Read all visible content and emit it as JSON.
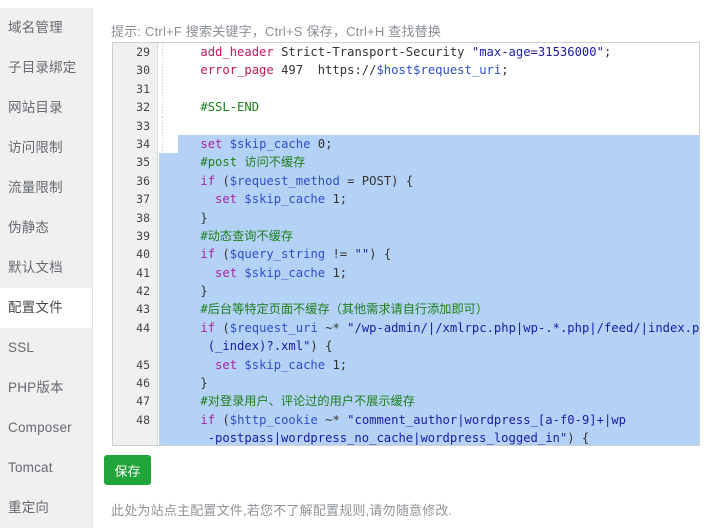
{
  "sidebar": {
    "items": [
      {
        "label": "域名管理",
        "active": false
      },
      {
        "label": "子目录绑定",
        "active": false
      },
      {
        "label": "网站目录",
        "active": false
      },
      {
        "label": "访问限制",
        "active": false
      },
      {
        "label": "流量限制",
        "active": false
      },
      {
        "label": "伪静态",
        "active": false
      },
      {
        "label": "默认文档",
        "active": false
      },
      {
        "label": "配置文件",
        "active": true
      },
      {
        "label": "SSL",
        "active": false
      },
      {
        "label": "PHP版本",
        "active": false
      },
      {
        "label": "Composer",
        "active": false
      },
      {
        "label": "Tomcat",
        "active": false
      },
      {
        "label": "重定向",
        "active": false
      }
    ]
  },
  "main": {
    "hint": "提示: Ctrl+F 搜索关键字，Ctrl+S 保存，Ctrl+H 查找替换",
    "save_label": "保存",
    "footer_note": "此处为站点主配置文件,若您不了解配置规则,请勿随意修改."
  },
  "editor": {
    "colors": {
      "selection": "#b4d2f5",
      "gutter_bg": "#f0f0f0",
      "comment": "#1d7f1d",
      "string": "#1a1aa6",
      "keyword": "#a626a4",
      "function": "#c2185b",
      "variable": "#2f4fc7",
      "accent_green": "#20a53a"
    },
    "gutter_numbers": [
      "29",
      "30",
      "31",
      "32",
      "33",
      "34",
      "35",
      "36",
      "37",
      "38",
      "39",
      "40",
      "41",
      "42",
      "43",
      "44",
      "",
      "45",
      "46",
      "47",
      "48",
      ""
    ],
    "lines": [
      {
        "n": "29",
        "selected": false,
        "partial": false,
        "tokens": [
          {
            "t": "    ",
            "c": "pl"
          },
          {
            "t": "add_header",
            "c": "fn"
          },
          {
            "t": " Strict-Transport-Security ",
            "c": "pl"
          },
          {
            "t": "\"max-age=31536000\"",
            "c": "str"
          },
          {
            "t": ";",
            "c": "pl"
          }
        ]
      },
      {
        "n": "30",
        "selected": false,
        "partial": false,
        "tokens": [
          {
            "t": "    ",
            "c": "pl"
          },
          {
            "t": "error_page",
            "c": "fn"
          },
          {
            "t": " 497  https://",
            "c": "pl"
          },
          {
            "t": "$host$request_uri",
            "c": "var"
          },
          {
            "t": ";",
            "c": "pl"
          }
        ]
      },
      {
        "n": "31",
        "selected": false,
        "partial": false,
        "tokens": []
      },
      {
        "n": "32",
        "selected": false,
        "partial": false,
        "tokens": [
          {
            "t": "    ",
            "c": "pl"
          },
          {
            "t": "#SSL-END",
            "c": "cmt"
          }
        ]
      },
      {
        "n": "33",
        "selected": false,
        "partial": false,
        "tokens": []
      },
      {
        "n": "34",
        "selected": true,
        "partial": true,
        "tokens": [
          {
            "t": "    ",
            "c": "pl"
          },
          {
            "t": "set",
            "c": "kw"
          },
          {
            "t": " ",
            "c": "pl"
          },
          {
            "t": "$skip_cache",
            "c": "var"
          },
          {
            "t": " 0;",
            "c": "pl"
          }
        ]
      },
      {
        "n": "35",
        "selected": true,
        "partial": false,
        "tokens": [
          {
            "t": "    ",
            "c": "pl"
          },
          {
            "t": "#post 访问不缓存",
            "c": "cmt"
          }
        ]
      },
      {
        "n": "36",
        "selected": true,
        "partial": false,
        "tokens": [
          {
            "t": "    ",
            "c": "pl"
          },
          {
            "t": "if",
            "c": "kw"
          },
          {
            "t": " (",
            "c": "pl"
          },
          {
            "t": "$request_method",
            "c": "var"
          },
          {
            "t": " = POST) {",
            "c": "pl"
          }
        ]
      },
      {
        "n": "37",
        "selected": true,
        "partial": false,
        "tokens": [
          {
            "t": "      ",
            "c": "pl"
          },
          {
            "t": "set",
            "c": "kw"
          },
          {
            "t": " ",
            "c": "pl"
          },
          {
            "t": "$skip_cache",
            "c": "var"
          },
          {
            "t": " 1;",
            "c": "pl"
          }
        ]
      },
      {
        "n": "38",
        "selected": true,
        "partial": false,
        "tokens": [
          {
            "t": "    }",
            "c": "pl"
          }
        ]
      },
      {
        "n": "39",
        "selected": true,
        "partial": false,
        "tokens": [
          {
            "t": "    ",
            "c": "pl"
          },
          {
            "t": "#动态查询不缓存",
            "c": "cmt"
          }
        ]
      },
      {
        "n": "40",
        "selected": true,
        "partial": false,
        "tokens": [
          {
            "t": "    ",
            "c": "pl"
          },
          {
            "t": "if",
            "c": "kw"
          },
          {
            "t": " (",
            "c": "pl"
          },
          {
            "t": "$query_string",
            "c": "var"
          },
          {
            "t": " != ",
            "c": "pl"
          },
          {
            "t": "\"\"",
            "c": "str"
          },
          {
            "t": ") {",
            "c": "pl"
          }
        ]
      },
      {
        "n": "41",
        "selected": true,
        "partial": false,
        "tokens": [
          {
            "t": "      ",
            "c": "pl"
          },
          {
            "t": "set",
            "c": "kw"
          },
          {
            "t": " ",
            "c": "pl"
          },
          {
            "t": "$skip_cache",
            "c": "var"
          },
          {
            "t": " 1;",
            "c": "pl"
          }
        ]
      },
      {
        "n": "42",
        "selected": true,
        "partial": false,
        "tokens": [
          {
            "t": "    }",
            "c": "pl"
          }
        ]
      },
      {
        "n": "43",
        "selected": true,
        "partial": false,
        "tokens": [
          {
            "t": "    ",
            "c": "pl"
          },
          {
            "t": "#后台等特定页面不缓存（其他需求请自行添加即可）",
            "c": "cmt"
          }
        ]
      },
      {
        "n": "44",
        "selected": true,
        "partial": false,
        "tokens": [
          {
            "t": "    ",
            "c": "pl"
          },
          {
            "t": "if",
            "c": "kw"
          },
          {
            "t": " (",
            "c": "pl"
          },
          {
            "t": "$request_uri",
            "c": "var"
          },
          {
            "t": " ~* ",
            "c": "pl"
          },
          {
            "t": "\"/wp-admin/|/xmlrpc.php|wp-.*.php|/feed/|index.php|sitemap",
            "c": "str"
          }
        ]
      },
      {
        "n": "",
        "selected": true,
        "partial": false,
        "wrap": true,
        "tokens": [
          {
            "t": "     ",
            "c": "pl"
          },
          {
            "t": "(_index)?.xml\"",
            "c": "str"
          },
          {
            "t": ") {",
            "c": "pl"
          }
        ]
      },
      {
        "n": "45",
        "selected": true,
        "partial": false,
        "tokens": [
          {
            "t": "      ",
            "c": "pl"
          },
          {
            "t": "set",
            "c": "kw"
          },
          {
            "t": " ",
            "c": "pl"
          },
          {
            "t": "$skip_cache",
            "c": "var"
          },
          {
            "t": " 1;",
            "c": "pl"
          }
        ]
      },
      {
        "n": "46",
        "selected": true,
        "partial": false,
        "tokens": [
          {
            "t": "    }",
            "c": "pl"
          }
        ]
      },
      {
        "n": "47",
        "selected": true,
        "partial": false,
        "tokens": [
          {
            "t": "    ",
            "c": "pl"
          },
          {
            "t": "#对登录用户、评论过的用户不展示缓存",
            "c": "cmt"
          }
        ]
      },
      {
        "n": "48",
        "selected": true,
        "partial": false,
        "tokens": [
          {
            "t": "    ",
            "c": "pl"
          },
          {
            "t": "if",
            "c": "kw"
          },
          {
            "t": " (",
            "c": "pl"
          },
          {
            "t": "$http_cookie",
            "c": "var"
          },
          {
            "t": " ~* ",
            "c": "pl"
          },
          {
            "t": "\"comment_author|wordpress_[a-f0-9]+|wp",
            "c": "str"
          }
        ]
      },
      {
        "n": "",
        "selected": true,
        "partial": false,
        "wrap": true,
        "tokens": [
          {
            "t": "     ",
            "c": "pl"
          },
          {
            "t": "-postpass|wordpress_no_cache|wordpress_logged_in\"",
            "c": "str"
          },
          {
            "t": ") {",
            "c": "pl"
          }
        ]
      }
    ]
  }
}
